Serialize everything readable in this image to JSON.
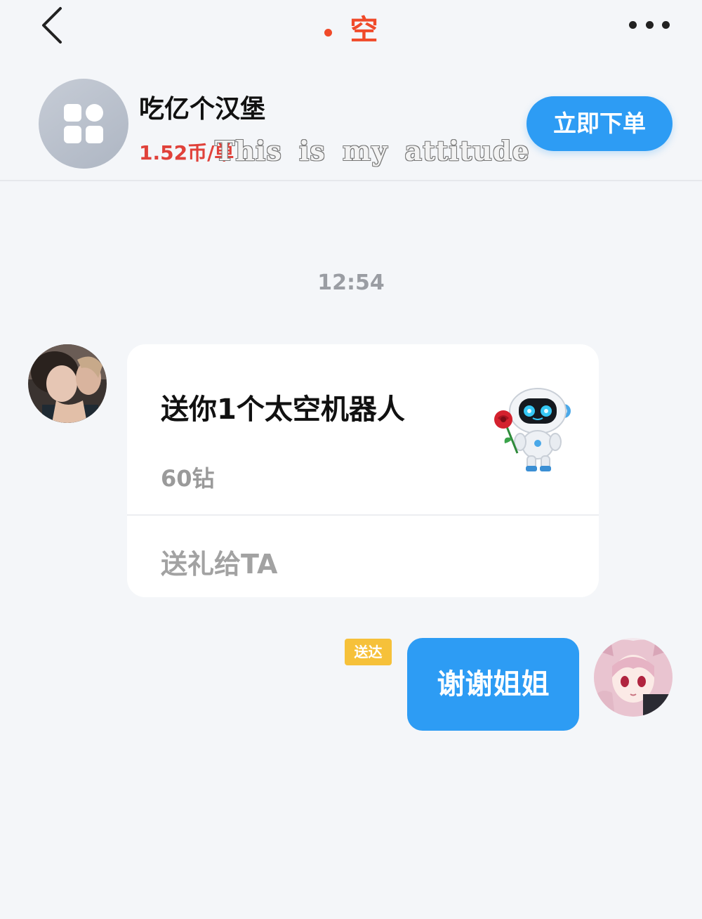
{
  "header": {
    "title": "空",
    "back_icon": "chevron-left-icon",
    "more_icon": "more-dots-icon",
    "title_color": "#f04a2a"
  },
  "merchant": {
    "name": "吃亿个汉堡",
    "price": "1.52币/单",
    "overlay_text": "This is my attitude",
    "order_button": "立即下单",
    "avatar_icon": "grid-apps-icon"
  },
  "chat": {
    "time": "12:54",
    "gift": {
      "title": "送你1个太空机器人",
      "price": "60钻",
      "action": "送礼给TA",
      "image_icon": "robot-with-rose-icon"
    },
    "sent": {
      "status": "送达",
      "text": "谢谢姐姐"
    }
  },
  "colors": {
    "accent_blue": "#2d9cf4",
    "price_red": "#e0413a",
    "status_yellow": "#f6c13a",
    "background": "#f4f6f9"
  }
}
